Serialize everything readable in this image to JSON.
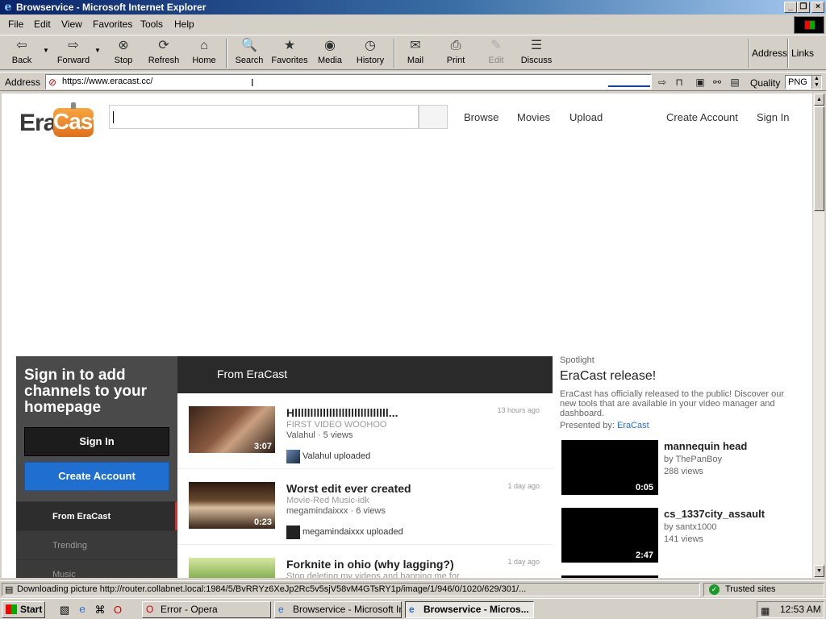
{
  "window": {
    "title": "Browservice - Microsoft Internet Explorer"
  },
  "menu": [
    "File",
    "Edit",
    "View",
    "Favorites",
    "Tools",
    "Help"
  ],
  "toolbar": {
    "buttons": [
      {
        "label": "Back",
        "icon": "back-arrow-icon"
      },
      {
        "label": "Forward",
        "icon": "forward-arrow-icon"
      },
      {
        "label": "Stop",
        "icon": "stop-icon"
      },
      {
        "label": "Refresh",
        "icon": "refresh-icon"
      },
      {
        "label": "Home",
        "icon": "home-icon"
      },
      {
        "label": "Search",
        "icon": "search-icon"
      },
      {
        "label": "Favorites",
        "icon": "favorites-icon"
      },
      {
        "label": "Media",
        "icon": "media-icon"
      },
      {
        "label": "History",
        "icon": "history-icon"
      },
      {
        "label": "Mail",
        "icon": "mail-icon"
      },
      {
        "label": "Print",
        "icon": "print-icon"
      },
      {
        "label": "Edit",
        "icon": "edit-icon"
      },
      {
        "label": "Discuss",
        "icon": "discuss-icon"
      }
    ],
    "address_label": "Address",
    "links_label": "Links"
  },
  "addressbar": {
    "label": "Address",
    "url": "https://www.eracast.cc/",
    "quality_label": "Quality",
    "quality_value": "PNG"
  },
  "page": {
    "logo": {
      "part1": "Era",
      "part2": "Cast"
    },
    "search_placeholder": "",
    "nav": [
      "Browse",
      "Movies",
      "Upload"
    ],
    "account": [
      "Create Account",
      "Sign In"
    ],
    "left": {
      "heading": "Sign in to add channels to your homepage",
      "signin": "Sign In",
      "create": "Create Account",
      "nav": [
        "From EraCast",
        "Trending",
        "Music"
      ]
    },
    "center": {
      "heading": "From EraCast",
      "items": [
        {
          "title": "Hllllllllllllllllllllllllllllll...",
          "desc": "FIRST VIDEO WOOHOO",
          "meta": "Valahul · 5 views",
          "age": "13 hours ago",
          "duration": "3:07",
          "uploader": "Valahul uploaded"
        },
        {
          "title": "Worst edit ever created",
          "desc": "Movie-Red Music-idk",
          "meta": "megamindaixxx · 6 views",
          "age": "1 day ago",
          "duration": "0:23",
          "uploader": "megamindaixxx uploaded"
        },
        {
          "title": "Forknite in ohio (why lagging?)",
          "desc": "Stop deleting my videos and banning me for",
          "meta": "",
          "age": "1 day ago",
          "duration": "",
          "uploader": ""
        }
      ]
    },
    "right": {
      "label": "Spotlight",
      "title": "EraCast release!",
      "desc": "EraCast has officially released to the public! Discover our new tools that are available in your video manager and dashboard.",
      "presented_prefix": "Presented by: ",
      "presented_by": "EraCast",
      "items": [
        {
          "title": "mannequin head",
          "by": "by ThePanBoy",
          "views": "288 views",
          "duration": "0:05"
        },
        {
          "title": "cs_1337city_assault",
          "by": "by santx1000",
          "views": "141 views",
          "duration": "2:47"
        }
      ]
    }
  },
  "status": {
    "text": "Downloading picture http://router.collabnet.local:1984/5/BvRRYz6XeJp2Rc5v5sjV58vM4GTsRY1p/image/1/946/0/1020/629/301/...",
    "zone": "Trusted sites"
  },
  "taskbar": {
    "start": "Start",
    "tasks": [
      {
        "label": "Error - Opera",
        "active": false
      },
      {
        "label": "Browservice - Microsoft Int...",
        "active": false
      },
      {
        "label": "Browservice - Micros...",
        "active": true
      }
    ],
    "clock": "12:53 AM"
  }
}
